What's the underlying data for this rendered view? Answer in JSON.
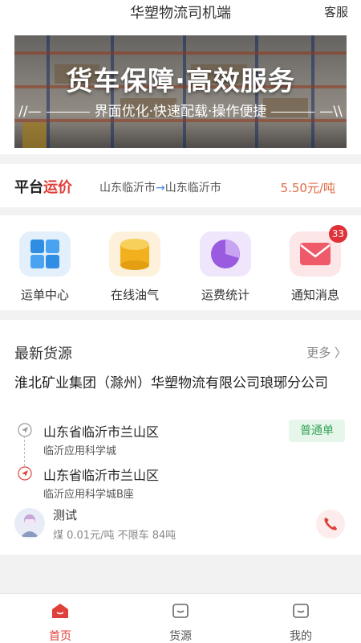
{
  "header": {
    "title": "华塑物流司机端",
    "service": "客服"
  },
  "banner": {
    "headline": "货车保障·高效服务",
    "sub": "界面优化·快速配载·操作便捷",
    "deco_left": "//—",
    "deco_right": "—\\\\"
  },
  "rate": {
    "label_a": "平台",
    "label_b": "运价",
    "from": "山东临沂市",
    "arrow": "→",
    "to": "山东临沂市",
    "price": "5.50元/吨"
  },
  "menu": [
    {
      "label": "运单中心",
      "icon": "grid-icon"
    },
    {
      "label": "在线油气",
      "icon": "fuel-icon"
    },
    {
      "label": "运费统计",
      "icon": "pie-chart-icon"
    },
    {
      "label": "通知消息",
      "icon": "mail-icon",
      "badge": "33"
    }
  ],
  "cargo": {
    "title": "最新货源",
    "more": "更多 〉",
    "company": "淮北矿业集团（滁州）华塑物流有限公司琅琊分公司",
    "from_addr": "山东省临沂市兰山区",
    "from_detail": "临沂应用科学城",
    "to_addr": "山东省临沂市兰山区",
    "to_detail": "临沂应用科学城B座",
    "tag": "普通单",
    "user": "测试",
    "meta": "煤 0.01元/吨 不限车 84吨"
  },
  "tabs": [
    {
      "label": "首页",
      "active": true
    },
    {
      "label": "货源",
      "active": false
    },
    {
      "label": "我的",
      "active": false
    }
  ],
  "colors": {
    "accent": "#e0403a",
    "price": "#e06a44",
    "tag_green": "#3aa55a",
    "link_blue": "#3b82f6"
  }
}
